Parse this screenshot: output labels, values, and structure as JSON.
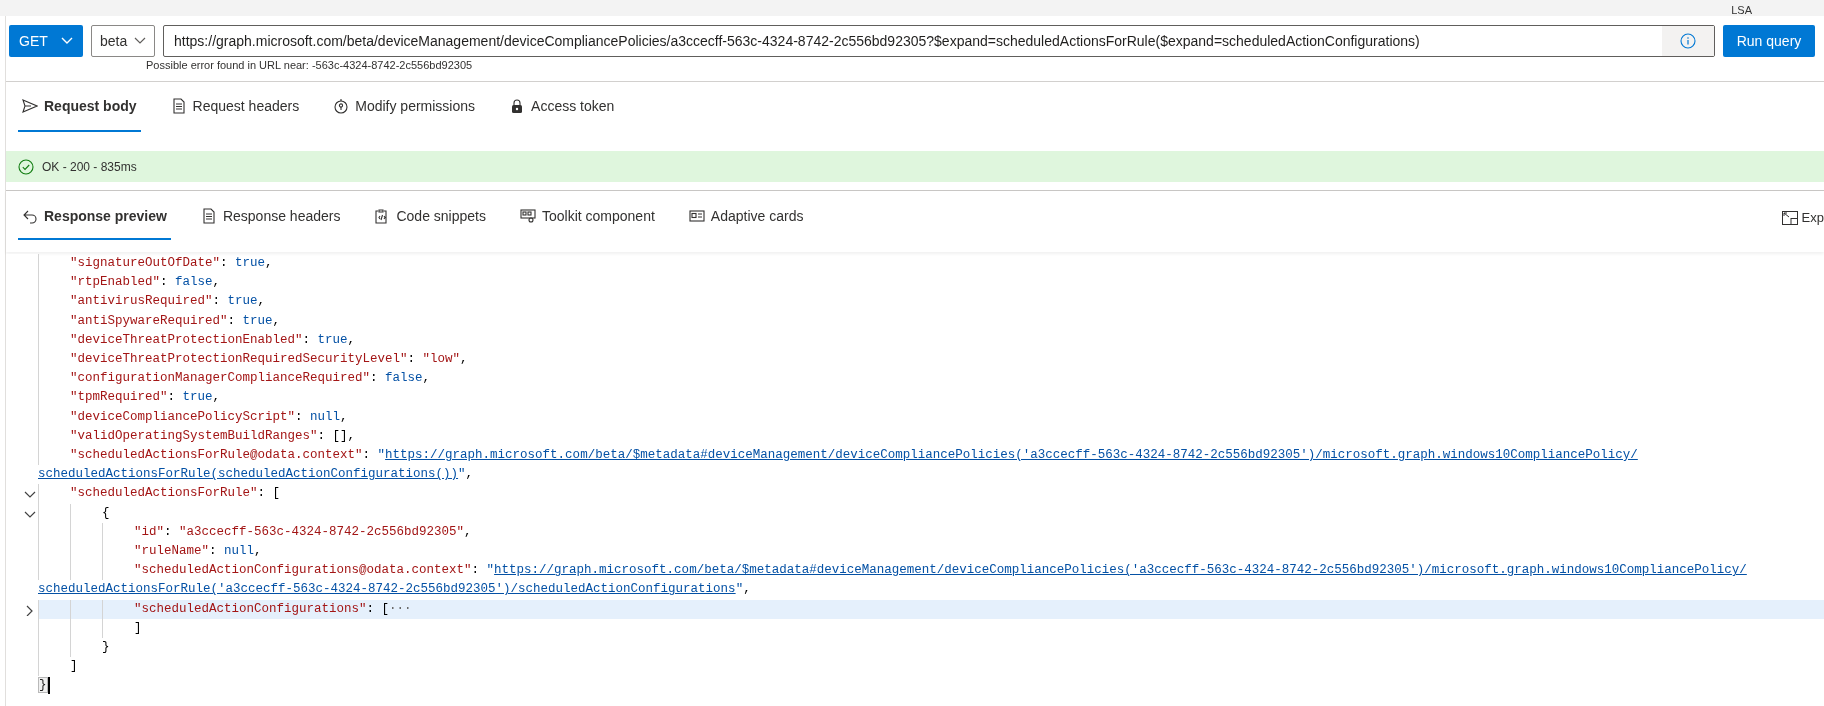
{
  "top_bar": {
    "user": "LSA"
  },
  "query": {
    "method": "GET",
    "version": "beta",
    "url": "https://graph.microsoft.com/beta/deviceManagement/deviceCompliancePolicies/a3ccecff-563c-4324-8742-2c556bd92305?$expand=scheduledActionsForRule($expand=scheduledActionConfigurations)",
    "error": "Possible error found in URL near: -563c-4324-8742-2c556bd92305",
    "run_button": "Run query"
  },
  "request_tabs": [
    {
      "label": "Request body",
      "selected": true
    },
    {
      "label": "Request headers",
      "selected": false
    },
    {
      "label": "Modify permissions",
      "selected": false
    },
    {
      "label": "Access token",
      "selected": false
    }
  ],
  "status": {
    "text": "OK - 200 - 835ms"
  },
  "response_tabs": [
    {
      "label": "Response preview",
      "selected": true
    },
    {
      "label": "Response headers",
      "selected": false
    },
    {
      "label": "Code snippets",
      "selected": false
    },
    {
      "label": "Toolkit component",
      "selected": false
    },
    {
      "label": "Adaptive cards",
      "selected": false
    }
  ],
  "expand": {
    "label": "Exp"
  },
  "code_lines": [
    {
      "children": [
        {
          "tokens": [
            {
              "kind": "key",
              "text": "\"signatureOutOfDate\""
            },
            {
              "kind": "punct",
              "text": ": "
            },
            {
              "kind": "keyword",
              "text": "true"
            },
            {
              "kind": "punct",
              "text": ","
            }
          ]
        },
        {
          "tokens": [
            {
              "kind": "key",
              "text": "\"rtpEnabled\""
            },
            {
              "kind": "punct",
              "text": ": "
            },
            {
              "kind": "keyword",
              "text": "false"
            },
            {
              "kind": "punct",
              "text": ","
            }
          ]
        },
        {
          "tokens": [
            {
              "kind": "key",
              "text": "\"antivirusRequired\""
            },
            {
              "kind": "punct",
              "text": ": "
            },
            {
              "kind": "keyword",
              "text": "true"
            },
            {
              "kind": "punct",
              "text": ","
            }
          ]
        },
        {
          "tokens": [
            {
              "kind": "key",
              "text": "\"antiSpywareRequired\""
            },
            {
              "kind": "punct",
              "text": ": "
            },
            {
              "kind": "keyword",
              "text": "true"
            },
            {
              "kind": "punct",
              "text": ","
            }
          ]
        },
        {
          "tokens": [
            {
              "kind": "key",
              "text": "\"deviceThreatProtectionEnabled\""
            },
            {
              "kind": "punct",
              "text": ": "
            },
            {
              "kind": "keyword",
              "text": "true"
            },
            {
              "kind": "punct",
              "text": ","
            }
          ]
        },
        {
          "tokens": [
            {
              "kind": "key",
              "text": "\"deviceThreatProtectionRequiredSecurityLevel\""
            },
            {
              "kind": "punct",
              "text": ": "
            },
            {
              "kind": "string",
              "text": "\"low\""
            },
            {
              "kind": "punct",
              "text": ","
            }
          ]
        },
        {
          "tokens": [
            {
              "kind": "key",
              "text": "\"configurationManagerComplianceRequired\""
            },
            {
              "kind": "punct",
              "text": ": "
            },
            {
              "kind": "keyword",
              "text": "false"
            },
            {
              "kind": "punct",
              "text": ","
            }
          ]
        },
        {
          "tokens": [
            {
              "kind": "key",
              "text": "\"tpmRequired\""
            },
            {
              "kind": "punct",
              "text": ": "
            },
            {
              "kind": "keyword",
              "text": "true"
            },
            {
              "kind": "punct",
              "text": ","
            }
          ]
        },
        {
          "tokens": [
            {
              "kind": "key",
              "text": "\"deviceCompliancePolicyScript\""
            },
            {
              "kind": "punct",
              "text": ": "
            },
            {
              "kind": "keyword",
              "text": "null"
            },
            {
              "kind": "punct",
              "text": ","
            }
          ]
        },
        {
          "tokens": [
            {
              "kind": "key",
              "text": "\"validOperatingSystemBuildRanges\""
            },
            {
              "kind": "punct",
              "text": ": [],"
            }
          ]
        },
        {
          "tokens": [
            {
              "kind": "key",
              "text": "\"scheduledActionsForRule@odata.context\""
            },
            {
              "kind": "punct",
              "text": ": "
            },
            {
              "kind": "quote",
              "text": "\""
            },
            {
              "kind": "link",
              "text": "https://graph.microsoft.com/beta/$metadata#deviceManagement/deviceCompliancePolicies('a3ccecff-563c-4324-8742-2c556bd92305')/microsoft.graph.windows10CompliancePolicy/"
            },
            {
              "kind": "link",
              "newline": true,
              "text": "scheduledActionsForRule(scheduledActionConfigurations())"
            },
            {
              "kind": "quote",
              "text": "\""
            },
            {
              "kind": "punct",
              "text": ","
            }
          ]
        },
        {
          "expanded": true,
          "tokens": [
            {
              "kind": "key",
              "text": "\"scheduledActionsForRule\""
            },
            {
              "kind": "punct",
              "text": ": ["
            }
          ],
          "children": [
            {
              "expanded": true,
              "tokens": [
                {
                  "kind": "punct",
                  "text": "{"
                }
              ],
              "children": [
                {
                  "tokens": [
                    {
                      "kind": "key",
                      "text": "\"id\""
                    },
                    {
                      "kind": "punct",
                      "text": ": "
                    },
                    {
                      "kind": "string",
                      "text": "\"a3ccecff-563c-4324-8742-2c556bd92305\""
                    },
                    {
                      "kind": "punct",
                      "text": ","
                    }
                  ]
                },
                {
                  "tokens": [
                    {
                      "kind": "key",
                      "text": "\"ruleName\""
                    },
                    {
                      "kind": "punct",
                      "text": ": "
                    },
                    {
                      "kind": "keyword",
                      "text": "null"
                    },
                    {
                      "kind": "punct",
                      "text": ","
                    }
                  ]
                },
                {
                  "tokens": [
                    {
                      "kind": "key",
                      "text": "\"scheduledActionConfigurations@odata.context\""
                    },
                    {
                      "kind": "punct",
                      "text": ": "
                    },
                    {
                      "kind": "quote",
                      "text": "\""
                    },
                    {
                      "kind": "link",
                      "text": "https://graph.microsoft.com/beta/$metadata#deviceManagement/deviceCompliancePolicies('a3ccecff-563c-4324-8742-2c556bd92305')/microsoft.graph.windows10CompliancePolicy/"
                    },
                    {
                      "kind": "link",
                      "newline": true,
                      "text": "scheduledActionsForRule('a3ccecff-563c-4324-8742-2c556bd92305')/scheduledActionConfigurations"
                    },
                    {
                      "kind": "quote",
                      "text": "\""
                    },
                    {
                      "kind": "punct",
                      "text": ","
                    }
                  ]
                },
                {
                  "expanded": false,
                  "selected": true,
                  "tokens": [
                    {
                      "kind": "key",
                      "text": "\"scheduledActionConfigurations\""
                    },
                    {
                      "kind": "punct",
                      "text": ": ["
                    },
                    {
                      "kind": "ellipsis",
                      "text": "···"
                    }
                  ]
                },
                {
                  "tokens": [
                    {
                      "kind": "punct",
                      "text": "]"
                    }
                  ]
                }
              ]
            },
            {
              "tokens": [
                {
                  "kind": "punct",
                  "text": "}"
                }
              ]
            }
          ]
        },
        {
          "tokens": [
            {
              "kind": "punct",
              "text": "]"
            }
          ]
        }
      ]
    },
    {
      "cursor": true,
      "tokens": [
        {
          "kind": "matched",
          "text": "}"
        }
      ]
    }
  ]
}
